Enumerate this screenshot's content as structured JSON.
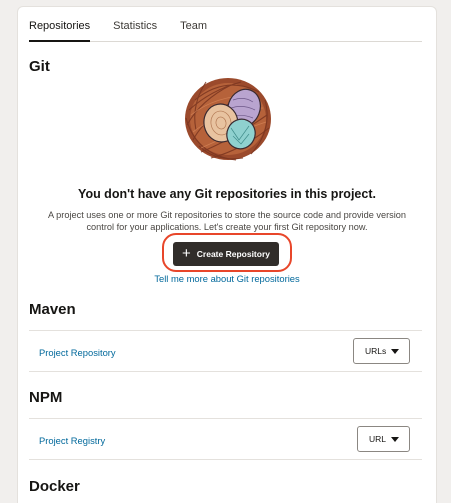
{
  "tabs": [
    {
      "label": "Repositories",
      "active": true
    },
    {
      "label": "Statistics",
      "active": false
    },
    {
      "label": "Team",
      "active": false
    }
  ],
  "git": {
    "title": "Git",
    "illustration_icon": "nest-with-eggs-icon",
    "empty_heading": "You don't have any Git repositories in this project.",
    "empty_desc_line1": "A project uses one or more Git repositories to store the source code and provide version",
    "empty_desc_line2": "control for your applications. Let's create your first Git repository now.",
    "create_button_label": "Create Repository",
    "create_button_icon": "plus-icon",
    "learn_more_link": "Tell me more about Git repositories"
  },
  "maven": {
    "title": "Maven",
    "row_link": "Project Repository",
    "select_value": "URLs"
  },
  "npm": {
    "title": "NPM",
    "row_link": "Project Registry",
    "select_value": "URL"
  },
  "docker": {
    "title": "Docker"
  },
  "colors": {
    "page_bg": "#f1efed",
    "primary_button": "#312d2a",
    "link": "#01689b",
    "highlight": "#e8462a"
  }
}
